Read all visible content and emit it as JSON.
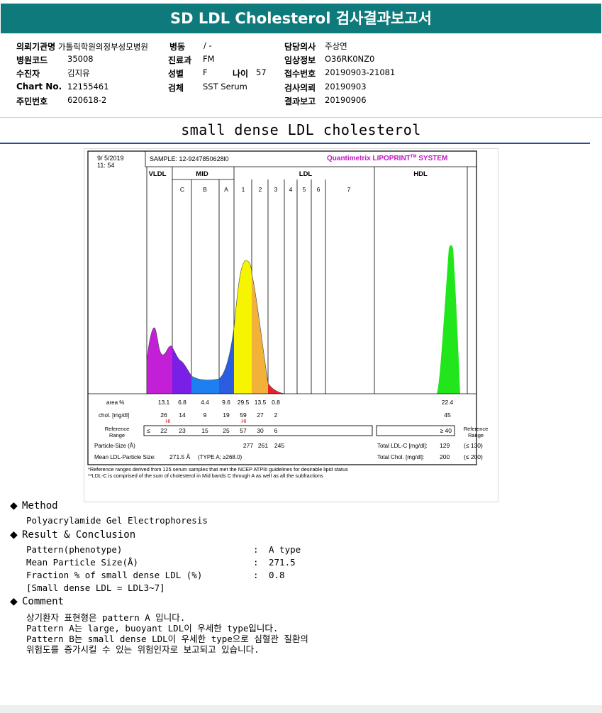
{
  "header": {
    "title": "SD LDL Cholesterol 검사결과보고서"
  },
  "info": {
    "col1": [
      {
        "label": "의뢰기관명",
        "value": "가톨릭학원의정부성모병원"
      },
      {
        "label": "병원코드",
        "value": "35008"
      },
      {
        "label": "수진자",
        "value": "김지유"
      },
      {
        "label": "Chart No.",
        "value": "12155461"
      },
      {
        "label": "주민번호",
        "value": "620618-2"
      }
    ],
    "col2": [
      {
        "label": "병동",
        "value": "/ -"
      },
      {
        "label": "진료과",
        "value": "FM"
      },
      {
        "label": "성별",
        "value": "F"
      },
      {
        "label": "검체",
        "value": "SST Serum"
      }
    ],
    "age": {
      "label": "나이",
      "value": "57"
    },
    "col3": [
      {
        "label": "담당의사",
        "value": "주상연"
      },
      {
        "label": "임상정보",
        "value": "O36RK0NZ0"
      },
      {
        "label": "접수번호",
        "value": "20190903-21081"
      },
      {
        "label": "검사의뢰",
        "value": "20190903"
      },
      {
        "label": "결과보고",
        "value": "20190906"
      }
    ]
  },
  "subtitle": "small dense LDL cholesterol",
  "report": {
    "date": "9/ 5/2019",
    "time": "11: 54",
    "sample": "SAMPLE: 12-9247850628l0",
    "brand": "Quantimetrix LIPOPRINT",
    "brand_sup": "TM",
    "brand_tail": " SYSTEM",
    "groups": [
      "VLDL",
      "MID",
      "LDL",
      "HDL"
    ],
    "bands": [
      "C",
      "B",
      "A",
      "1",
      "2",
      "3",
      "4",
      "5",
      "6",
      "7"
    ],
    "area_label": "area %",
    "area": [
      "13.1",
      "6.8",
      "4.4",
      "9.6",
      "29.5",
      "13.5",
      "0.8",
      "22.4"
    ],
    "chol_label": "chol. [mg/dl]",
    "chol": [
      "26",
      "14",
      "9",
      "19",
      "59",
      "27",
      "2",
      "45"
    ],
    "hi": "HI",
    "ref_label": "Reference\nRange",
    "ref_le": "≤",
    "ref": [
      "22",
      "23",
      "15",
      "25",
      "57",
      "30",
      "6"
    ],
    "ref_hdl": "≥ 40",
    "particle_label": "Particle-Size (Å)",
    "particle": [
      "277",
      "261",
      "245"
    ],
    "total_ldl_label": "Total LDL-C [mg/dl]:",
    "total_ldl": "129",
    "total_ldl_ref": "(≤ 130)",
    "mean_label": "Mean LDL-Particle Size:",
    "mean_value": "271.5 Å",
    "mean_type": "(TYPE A; ≥268.0)",
    "total_chol_label": "Total Chol. [mg/dl]:",
    "total_chol": "200",
    "total_chol_ref": "(≤ 200)",
    "note1": "*Reference ranges derived from 125 serum samples that met the NCEP ATPIII guidelines for desirable lipid status",
    "note2": "**LDL-C is comprised of the sum of cholesterol in Mid bands C through A as well as all the subfractions"
  },
  "method": {
    "title": "Method",
    "text": "Polyacrylamide Gel Electrophoresis"
  },
  "result": {
    "title": "Result & Conclusion",
    "rows": [
      {
        "label": "Pattern(phenotype)",
        "sep": ":",
        "value": "A type"
      },
      {
        "label": "Mean Particle Size(Å)",
        "sep": ":",
        "value": "271.5"
      },
      {
        "label": "Fraction % of small dense LDL (%)",
        "sep": ":",
        "value": "0.8"
      }
    ],
    "note": "[Small dense LDL = LDL3~7]"
  },
  "comment": {
    "title": "Comment",
    "lines": [
      "상기환자 표현형은 pattern A 입니다.",
      "Pattern A는 large, buoyant LDL이 우세한 type입니다.",
      "Pattern B는 small dense LDL이 우세한 type으로 심혈관 질환의",
      "위험도를 증가시킬 수 있는 위험인자로 보고되고 있습니다."
    ]
  },
  "colors": {
    "header_band": "#0f7a7b",
    "rule": "#1f4e9a",
    "vldl": "#c21fd6",
    "midc": "#7a1fe6",
    "midb": "#1e7ff0",
    "mida": "#2a5de0",
    "ldl1": "#f6f400",
    "ldl2": "#f2b23a",
    "ldl3": "#e8232a",
    "hdl": "#22e61c",
    "brand": "#c414c4",
    "hi": "#d61414"
  }
}
